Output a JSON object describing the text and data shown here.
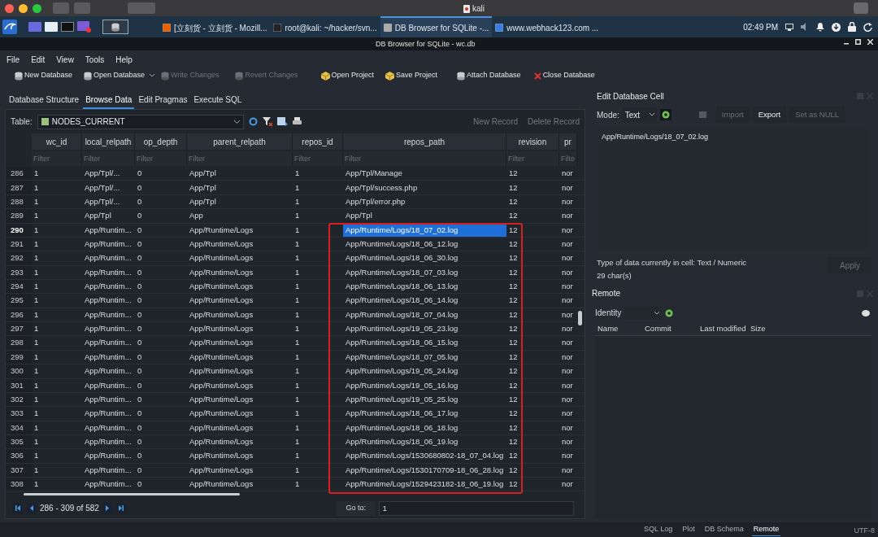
{
  "mac_titlebar": {
    "title": "kali"
  },
  "taskbar": {
    "tasks": [
      {
        "label": "[立刻货 - 立刻货 - Mozill...",
        "selected": false
      },
      {
        "label": "root@kali: ~/hacker/svn...",
        "selected": false
      },
      {
        "label": "DB Browser for SQLite -...",
        "selected": true
      },
      {
        "label": "www.webhack123.com ...",
        "selected": false
      }
    ],
    "clock": "02:49 PM"
  },
  "window": {
    "title": "DB Browser for SQLite - wc.db"
  },
  "menu": [
    "File",
    "Edit",
    "View",
    "Tools",
    "Help"
  ],
  "toolbar": [
    {
      "label": "New Database",
      "kind": "database",
      "disabled": false,
      "dropdown": false
    },
    {
      "label": "Open Database",
      "kind": "database",
      "disabled": false,
      "dropdown": true
    },
    {
      "label": "Write Changes",
      "kind": "database",
      "disabled": true,
      "dropdown": false
    },
    {
      "label": "Revert Changes",
      "kind": "database",
      "disabled": true,
      "dropdown": false
    },
    {
      "label": "Open Project",
      "kind": "project",
      "disabled": false,
      "dropdown": false
    },
    {
      "label": "Save Project",
      "kind": "project",
      "disabled": false,
      "dropdown": false
    },
    {
      "label": "Attach Database",
      "kind": "database",
      "disabled": false,
      "dropdown": false
    },
    {
      "label": "Close Database",
      "kind": "close",
      "disabled": false,
      "dropdown": false
    }
  ],
  "tabs": [
    {
      "label": "Database Structure",
      "selected": false
    },
    {
      "label": "Browse Data",
      "selected": true
    },
    {
      "label": "Edit Pragmas",
      "selected": false
    },
    {
      "label": "Execute SQL",
      "selected": false
    }
  ],
  "browse": {
    "table_label": "Table:",
    "table_name": "NODES_CURRENT",
    "new_record": "New Record",
    "delete_record": "Delete Record"
  },
  "table": {
    "columns": [
      {
        "label": "wc_id",
        "placeholder": "Filter"
      },
      {
        "label": "local_relpath",
        "placeholder": "Filter"
      },
      {
        "label": "op_depth",
        "placeholder": "Filter"
      },
      {
        "label": "parent_relpath",
        "placeholder": "Filter"
      },
      {
        "label": "repos_id",
        "placeholder": "Filter"
      },
      {
        "label": "repos_path",
        "placeholder": "Filter"
      },
      {
        "label": "revision",
        "placeholder": "Filter"
      },
      {
        "label": "pr",
        "placeholder": "Filte"
      }
    ],
    "rows": [
      {
        "number": "286",
        "cells": [
          "1",
          "App/Tpl/...",
          "0",
          "App/Tpl",
          "1",
          "App/Tpl/Manage",
          "12",
          "nor"
        ],
        "selected": false,
        "annotated": false
      },
      {
        "number": "287",
        "cells": [
          "1",
          "App/Tpl/...",
          "0",
          "App/Tpl",
          "1",
          "App/Tpl/success.php",
          "12",
          "nor"
        ],
        "selected": false,
        "annotated": false
      },
      {
        "number": "288",
        "cells": [
          "1",
          "App/Tpl/...",
          "0",
          "App/Tpl",
          "1",
          "App/Tpl/error.php",
          "12",
          "nor"
        ],
        "selected": false,
        "annotated": false
      },
      {
        "number": "289",
        "cells": [
          "1",
          "App/Tpl",
          "0",
          "App",
          "1",
          "App/Tpl",
          "12",
          "nor"
        ],
        "selected": false,
        "annotated": false
      },
      {
        "number": "290",
        "cells": [
          "1",
          "App/Runtim...",
          "0",
          "App/Runtime/Logs",
          "1",
          "App/Runtime/Logs/18_07_02.log",
          "12",
          "nor"
        ],
        "selected": true,
        "annotated": true
      },
      {
        "number": "291",
        "cells": [
          "1",
          "App/Runtim...",
          "0",
          "App/Runtime/Logs",
          "1",
          "App/Runtime/Logs/18_06_12.log",
          "12",
          "nor"
        ],
        "selected": false,
        "annotated": true
      },
      {
        "number": "292",
        "cells": [
          "1",
          "App/Runtim...",
          "0",
          "App/Runtime/Logs",
          "1",
          "App/Runtime/Logs/18_06_30.log",
          "12",
          "nor"
        ],
        "selected": false,
        "annotated": true
      },
      {
        "number": "293",
        "cells": [
          "1",
          "App/Runtim...",
          "0",
          "App/Runtime/Logs",
          "1",
          "App/Runtime/Logs/18_07_03.log",
          "12",
          "nor"
        ],
        "selected": false,
        "annotated": true
      },
      {
        "number": "294",
        "cells": [
          "1",
          "App/Runtim...",
          "0",
          "App/Runtime/Logs",
          "1",
          "App/Runtime/Logs/18_06_13.log",
          "12",
          "nor"
        ],
        "selected": false,
        "annotated": true
      },
      {
        "number": "295",
        "cells": [
          "1",
          "App/Runtim...",
          "0",
          "App/Runtime/Logs",
          "1",
          "App/Runtime/Logs/18_06_14.log",
          "12",
          "nor"
        ],
        "selected": false,
        "annotated": true
      },
      {
        "number": "296",
        "cells": [
          "1",
          "App/Runtim...",
          "0",
          "App/Runtime/Logs",
          "1",
          "App/Runtime/Logs/18_07_04.log",
          "12",
          "nor"
        ],
        "selected": false,
        "annotated": true
      },
      {
        "number": "297",
        "cells": [
          "1",
          "App/Runtim...",
          "0",
          "App/Runtime/Logs",
          "1",
          "App/Runtime/Logs/19_05_23.log",
          "12",
          "nor"
        ],
        "selected": false,
        "annotated": true
      },
      {
        "number": "298",
        "cells": [
          "1",
          "App/Runtim...",
          "0",
          "App/Runtime/Logs",
          "1",
          "App/Runtime/Logs/18_06_15.log",
          "12",
          "nor"
        ],
        "selected": false,
        "annotated": true
      },
      {
        "number": "299",
        "cells": [
          "1",
          "App/Runtim...",
          "0",
          "App/Runtime/Logs",
          "1",
          "App/Runtime/Logs/18_07_05.log",
          "12",
          "nor"
        ],
        "selected": false,
        "annotated": true
      },
      {
        "number": "300",
        "cells": [
          "1",
          "App/Runtim...",
          "0",
          "App/Runtime/Logs",
          "1",
          "App/Runtime/Logs/19_05_24.log",
          "12",
          "nor"
        ],
        "selected": false,
        "annotated": true
      },
      {
        "number": "301",
        "cells": [
          "1",
          "App/Runtim...",
          "0",
          "App/Runtime/Logs",
          "1",
          "App/Runtime/Logs/19_05_16.log",
          "12",
          "nor"
        ],
        "selected": false,
        "annotated": true
      },
      {
        "number": "302",
        "cells": [
          "1",
          "App/Runtim...",
          "0",
          "App/Runtime/Logs",
          "1",
          "App/Runtime/Logs/19_05_25.log",
          "12",
          "nor"
        ],
        "selected": false,
        "annotated": true
      },
      {
        "number": "303",
        "cells": [
          "1",
          "App/Runtim...",
          "0",
          "App/Runtime/Logs",
          "1",
          "App/Runtime/Logs/18_06_17.log",
          "12",
          "nor"
        ],
        "selected": false,
        "annotated": true
      },
      {
        "number": "304",
        "cells": [
          "1",
          "App/Runtim...",
          "0",
          "App/Runtime/Logs",
          "1",
          "App/Runtime/Logs/18_06_18.log",
          "12",
          "nor"
        ],
        "selected": false,
        "annotated": true
      },
      {
        "number": "305",
        "cells": [
          "1",
          "App/Runtim...",
          "0",
          "App/Runtime/Logs",
          "1",
          "App/Runtime/Logs/18_06_19.log",
          "12",
          "nor"
        ],
        "selected": false,
        "annotated": true
      },
      {
        "number": "306",
        "cells": [
          "1",
          "App/Runtim...",
          "0",
          "App/Runtime/Logs",
          "1",
          "App/Runtime/Logs/1530680802-18_07_04.log",
          "12",
          "nor"
        ],
        "selected": false,
        "annotated": true
      },
      {
        "number": "307",
        "cells": [
          "1",
          "App/Runtim...",
          "0",
          "App/Runtime/Logs",
          "1",
          "App/Runtime/Logs/1530170709-18_06_28.log",
          "12",
          "nor"
        ],
        "selected": false,
        "annotated": true
      },
      {
        "number": "308",
        "cells": [
          "1",
          "App/Runtim...",
          "0",
          "App/Runtime/Logs",
          "1",
          "App/Runtime/Logs/1529423182-18_06_19.log",
          "12",
          "nor"
        ],
        "selected": false,
        "annotated": true
      }
    ]
  },
  "pager": {
    "range": "286 - 309 of 582",
    "goto_label": "Go to:",
    "goto_value": "1"
  },
  "edit_cell": {
    "title": "Edit Database Cell",
    "mode_label": "Mode:",
    "mode": "Text",
    "buttons": [
      {
        "label": "Import",
        "disabled": true
      },
      {
        "label": "Export",
        "disabled": false
      },
      {
        "label": "Set as NULL",
        "disabled": true
      }
    ],
    "value": "App/Runtime/Logs/18_07_02.log",
    "type_info": "Type of data currently in cell: Text / Numeric",
    "char_count": "29 char(s)",
    "apply": {
      "label": "Apply",
      "disabled": true
    }
  },
  "remote": {
    "title": "Remote",
    "identity_label": "Identity",
    "columns": [
      "Name",
      "Commit",
      "Last modified",
      "Size"
    ]
  },
  "bottom_tabs": [
    {
      "label": "SQL Log",
      "selected": false
    },
    {
      "label": "Plot",
      "selected": false
    },
    {
      "label": "DB Schema",
      "selected": false
    },
    {
      "label": "Remote",
      "selected": true
    }
  ],
  "status": {
    "encoding": "UTF-8"
  }
}
